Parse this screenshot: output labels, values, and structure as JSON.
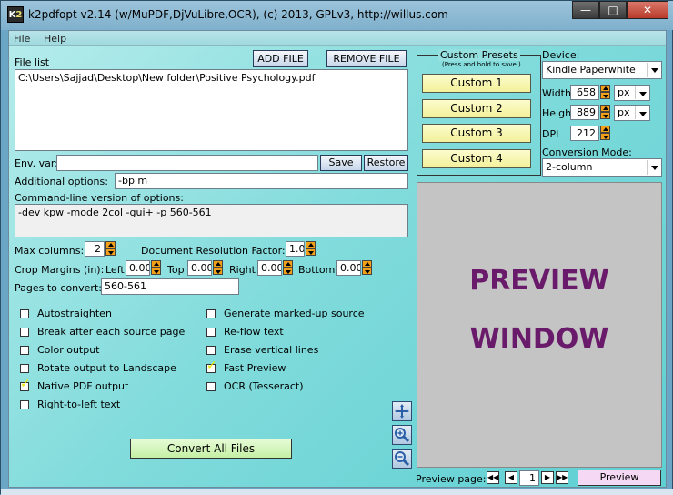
{
  "window": {
    "icon_text": "K2",
    "title": "k2pdfopt v2.14 (w/MuPDF,DjVuLibre,OCR), (c) 2013, GPLv3, http://willus.com"
  },
  "menu": {
    "file": "File",
    "help": "Help"
  },
  "file_list": {
    "label": "File list",
    "add_file": "ADD FILE",
    "remove_file": "REMOVE FILE",
    "items": [
      "C:\\Users\\Sajjad\\Desktop\\New folder\\Positive Psychology.pdf"
    ]
  },
  "env_var": {
    "label": "Env. var:",
    "value": "",
    "save": "Save",
    "restore": "Restore"
  },
  "additional_options": {
    "label": "Additional options:",
    "value": "-bp m"
  },
  "command_line": {
    "label": "Command-line version of options:",
    "value": "-dev kpw -mode 2col -gui+ -p 560-561"
  },
  "max_columns": {
    "label": "Max columns:",
    "value": "2"
  },
  "doc_resolution": {
    "label": "Document Resolution Factor:",
    "value": "1.0"
  },
  "crop_margins": {
    "label": "Crop Margins (in):",
    "left_label": "Left",
    "left": "0.00",
    "top_label": "Top",
    "top": "0.00",
    "right_label": "Right",
    "right": "0.00",
    "bottom_label": "Bottom",
    "bottom": "0.00"
  },
  "pages": {
    "label": "Pages to convert:",
    "value": "560-561"
  },
  "checkboxes_left": [
    {
      "label": "Autostraighten",
      "checked": false
    },
    {
      "label": "Break after each source page",
      "checked": false
    },
    {
      "label": "Color output",
      "checked": false
    },
    {
      "label": "Rotate output to Landscape",
      "checked": false
    },
    {
      "label": "Native PDF output",
      "checked": true
    },
    {
      "label": "Right-to-left text",
      "checked": false
    }
  ],
  "checkboxes_right": [
    {
      "label": "Generate marked-up source",
      "checked": false
    },
    {
      "label": "Re-flow text",
      "checked": false
    },
    {
      "label": "Erase vertical lines",
      "checked": false
    },
    {
      "label": "Fast Preview",
      "checked": true
    },
    {
      "label": "OCR (Tesseract)",
      "checked": false
    }
  ],
  "convert_button": "Convert All Files",
  "presets": {
    "title": "Custom Presets",
    "subtitle": "(Press and hold to save.)",
    "items": [
      "Custom 1",
      "Custom 2",
      "Custom 3",
      "Custom 4"
    ]
  },
  "device": {
    "label": "Device:",
    "selected": "Kindle Paperwhite",
    "width_label": "Width",
    "width": "658",
    "width_unit": "px",
    "height_label": "Height",
    "height": "889",
    "height_unit": "px",
    "dpi_label": "DPI",
    "dpi": "212"
  },
  "conversion_mode": {
    "label": "Conversion Mode:",
    "selected": "2-column"
  },
  "preview": {
    "line1": "PREVIEW",
    "line2": "WINDOW"
  },
  "preview_nav": {
    "label": "Preview page:",
    "page": "1",
    "button": "Preview"
  },
  "colors": {
    "accent": "#6a1a6a",
    "checkmark": "#e8e800",
    "spinner": "#f2a018"
  }
}
